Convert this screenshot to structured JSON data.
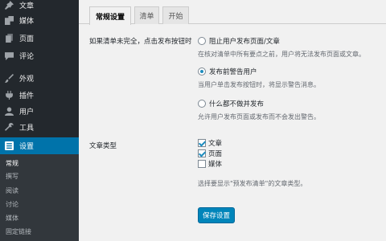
{
  "sidebar": {
    "items": [
      {
        "label": "文章",
        "icon": "pin-icon"
      },
      {
        "label": "媒体",
        "icon": "media-icon"
      },
      {
        "label": "页面",
        "icon": "page-icon"
      },
      {
        "label": "评论",
        "icon": "comment-icon"
      },
      {
        "label": "外观",
        "icon": "brush-icon"
      },
      {
        "label": "插件",
        "icon": "plugin-icon"
      },
      {
        "label": "用户",
        "icon": "user-icon"
      },
      {
        "label": "工具",
        "icon": "wrench-icon"
      },
      {
        "label": "设置",
        "icon": "settings-icon"
      }
    ],
    "submenu": [
      "常规",
      "撰写",
      "阅读",
      "讨论",
      "媒体",
      "固定链接"
    ]
  },
  "tabs": [
    "常规设置",
    "清单",
    "开始"
  ],
  "settings": {
    "incomplete_label": "如果清单未完全，点击发布按钮时",
    "options": [
      {
        "label": "阻止用户发布页面/文章",
        "desc": "在核对清单中所有要点之前，用户将无法发布页面或文章。",
        "checked": false
      },
      {
        "label": "发布前警告用户",
        "desc": "当用户单击发布按钮时，将显示警告消息。",
        "checked": true
      },
      {
        "label": "什么都不做并发布",
        "desc": "允许用户发布页面或发布而不会发出警告。",
        "checked": false
      }
    ],
    "post_types_label": "文章类型",
    "post_types": [
      {
        "label": "文章",
        "checked": true
      },
      {
        "label": "页面",
        "checked": true
      },
      {
        "label": "媒体",
        "checked": false
      }
    ],
    "post_types_desc": "选择要显示\"预发布清单\"的文章类型。",
    "save_label": "保存设置"
  },
  "colors": {
    "sidebar": "#23282d",
    "accent": "#0073aa",
    "button": "#0085ba"
  }
}
